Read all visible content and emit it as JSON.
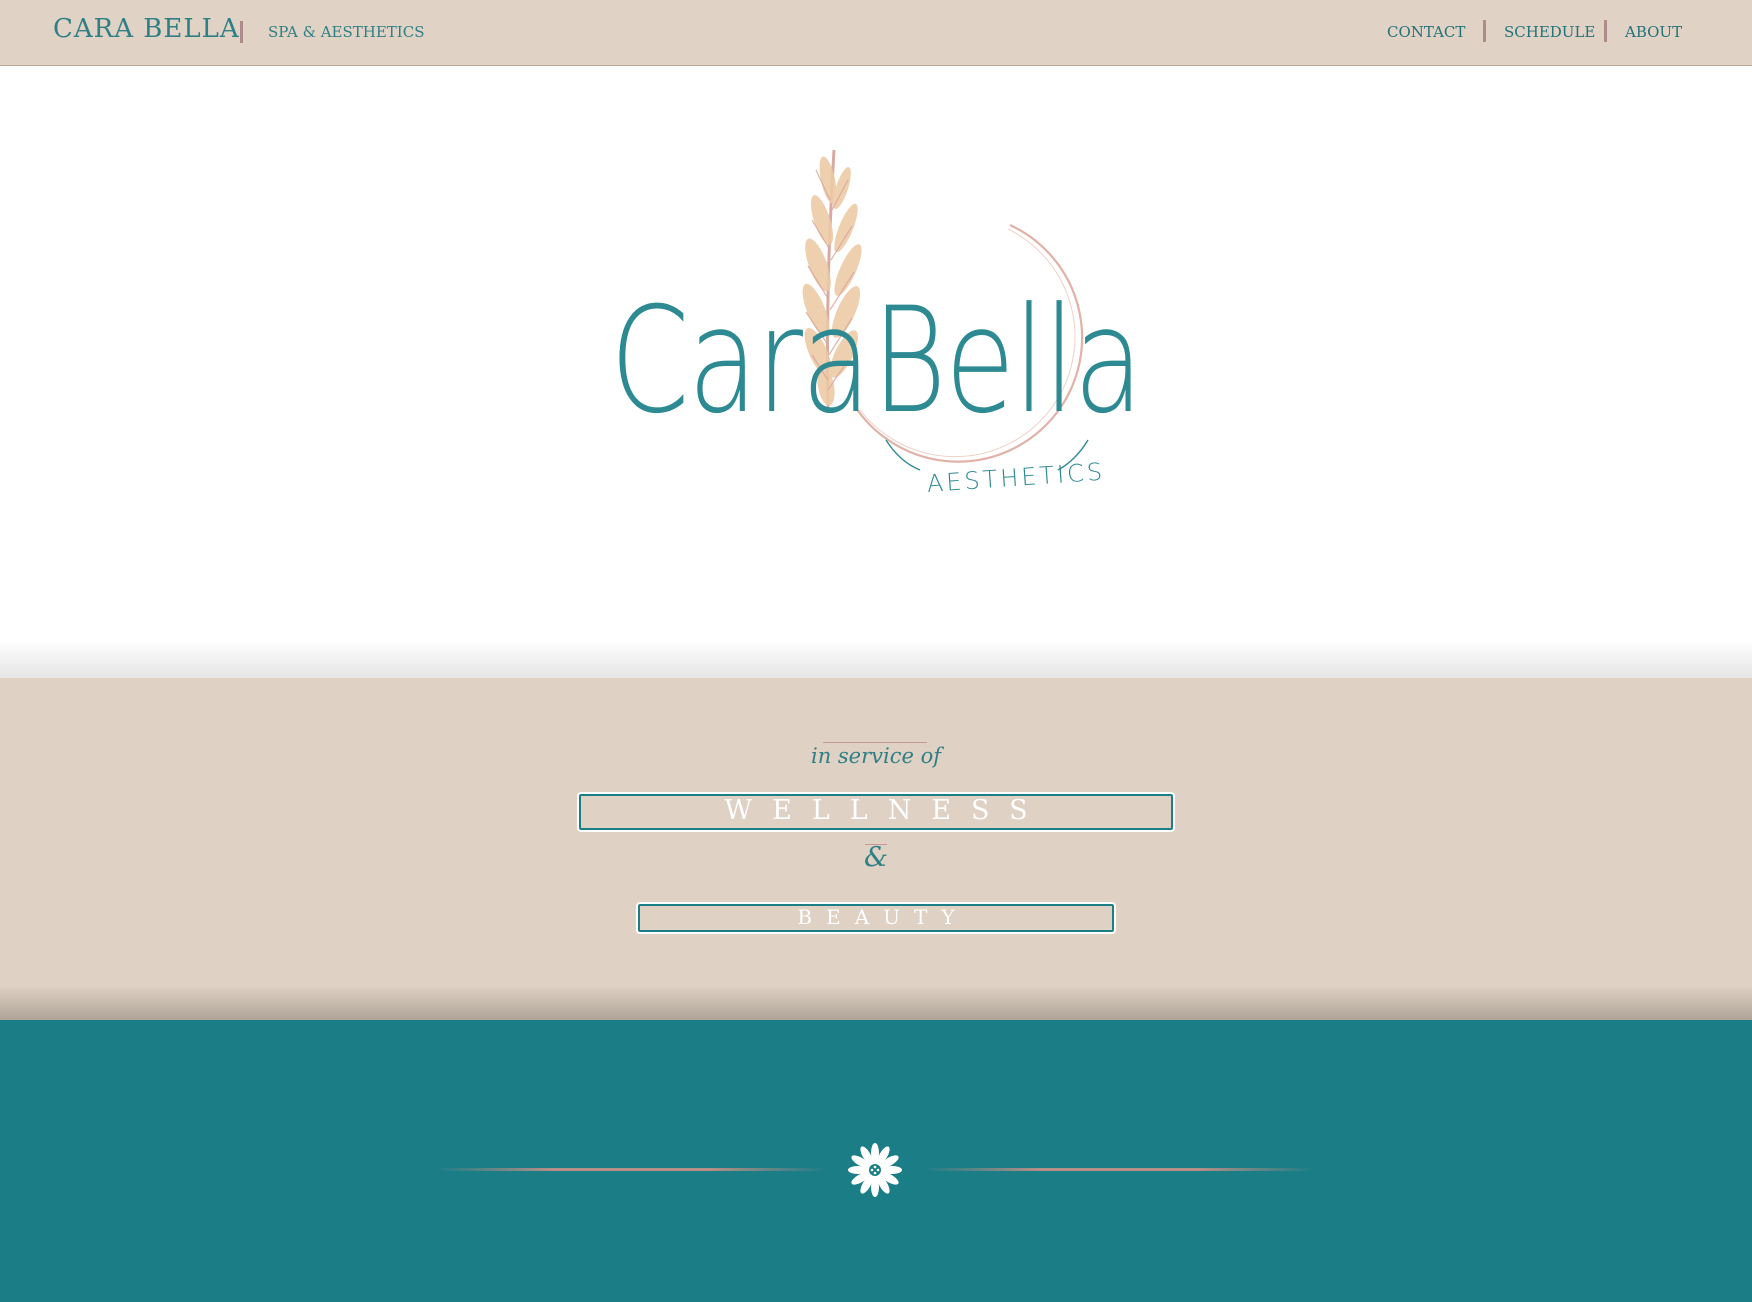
{
  "header": {
    "brand": "CARA BELLA",
    "tagline": "SPA & AESTHETICS",
    "nav": [
      {
        "label": "CONTACT"
      },
      {
        "label": "SCHEDULE"
      },
      {
        "label": "ABOUT"
      }
    ]
  },
  "logo": {
    "word_left": "Cara",
    "word_right": "Bella",
    "ring_text": "AESTHETICS"
  },
  "intro": {
    "lead": "in service of",
    "primary_button": "WELLNESS",
    "joiner": "&",
    "secondary_button": "BEAUTY"
  },
  "footer": {
    "ornament": "flower-ornament-icon"
  },
  "colors": {
    "teal": "#1b7e86",
    "tan": "#e0d2c4",
    "rose": "#b98e86",
    "wheat": "#ecc9a8"
  }
}
